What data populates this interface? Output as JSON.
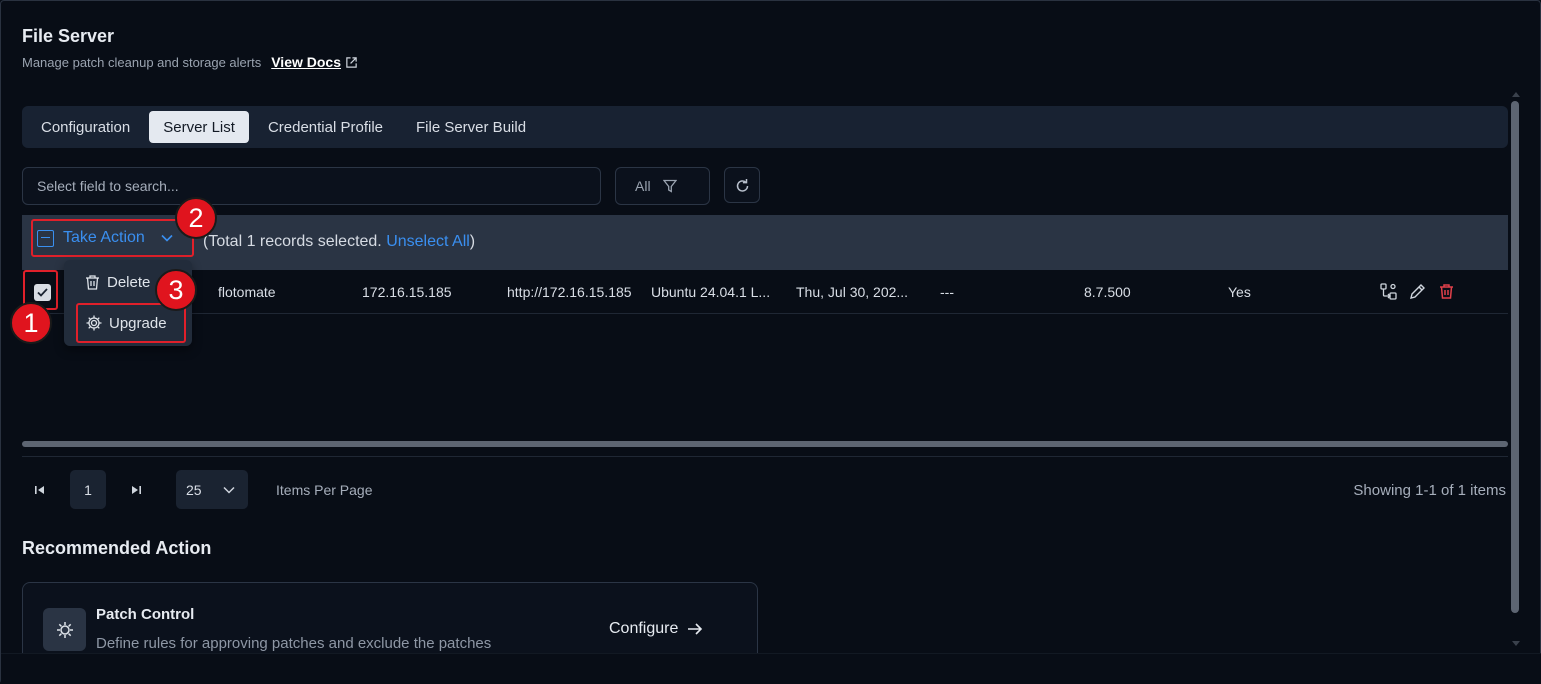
{
  "header": {
    "title": "File Server",
    "subtitle": "Manage patch cleanup and storage alerts",
    "docs_link": "View Docs"
  },
  "tabs": [
    {
      "label": "Configuration",
      "active": false
    },
    {
      "label": "Server List",
      "active": true
    },
    {
      "label": "Credential Profile",
      "active": false
    },
    {
      "label": "File Server Build",
      "active": false
    }
  ],
  "toolbar": {
    "search_placeholder": "Select field to search...",
    "filter_value": "All"
  },
  "selection": {
    "take_action_label": "Take Action",
    "prefix": "(Total 1 records selected. ",
    "unselect_label": "Unselect All",
    "suffix": ")"
  },
  "dropdown": {
    "items": [
      {
        "label": "Delete",
        "icon": "trash-icon"
      },
      {
        "label": "Upgrade",
        "icon": "gear-icon"
      }
    ]
  },
  "table": {
    "rows": [
      {
        "checked": true,
        "name": "flotomate",
        "ip": "172.16.15.185",
        "url": "http://172.16.15.185",
        "os": "Ubuntu 24.04.1 L...",
        "date": "Thu, Jul 30, 202...",
        "col6": "---",
        "version": "8.7.500",
        "status": "Yes"
      }
    ]
  },
  "pagination": {
    "current_page": "1",
    "per_page": "25",
    "items_per_page_label": "Items Per Page",
    "showing_text": "Showing 1-1 of 1 items"
  },
  "recommended": {
    "title": "Recommended Action",
    "card": {
      "title": "Patch Control",
      "description": "Define rules for approving patches and exclude the patches",
      "button_label": "Configure"
    }
  },
  "annotations": [
    "1",
    "2",
    "3"
  ],
  "colors": {
    "accent": "#3a8ff0",
    "annotation_red": "#e0202a",
    "danger": "#e0404a",
    "background": "#080d16"
  }
}
